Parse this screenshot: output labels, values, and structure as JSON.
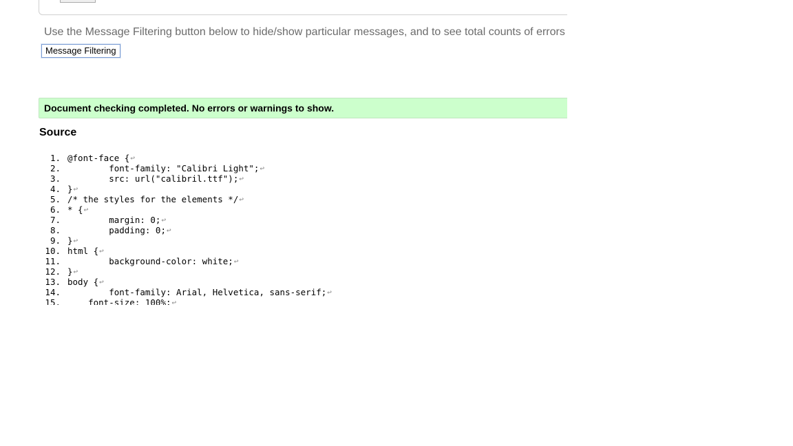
{
  "filter_info": "Use the Message Filtering button below to hide/show particular messages, and to see total counts of errors",
  "filter_button_label": "Message Filtering",
  "result_message": "Document checking completed. No errors or warnings to show.",
  "source_heading": "Source",
  "line_end_symbol": "↩",
  "source_lines": [
    {
      "num": "1.",
      "code": "@font-face {"
    },
    {
      "num": "2.",
      "code": "        font-family: \"Calibri Light\";"
    },
    {
      "num": "3.",
      "code": "        src: url(\"calibril.ttf\");"
    },
    {
      "num": "4.",
      "code": "}"
    },
    {
      "num": "5.",
      "code": "/* the styles for the elements */"
    },
    {
      "num": "6.",
      "code": "* {"
    },
    {
      "num": "7.",
      "code": "        margin: 0;"
    },
    {
      "num": "8.",
      "code": "        padding: 0;"
    },
    {
      "num": "9.",
      "code": "}"
    },
    {
      "num": "10.",
      "code": "html {"
    },
    {
      "num": "11.",
      "code": "        background-color: white;"
    },
    {
      "num": "12.",
      "code": "}"
    },
    {
      "num": "13.",
      "code": "body {"
    },
    {
      "num": "14.",
      "code": "        font-family: Arial, Helvetica, sans-serif;"
    },
    {
      "num": "15.",
      "code": "    font-size: 100%;"
    }
  ]
}
